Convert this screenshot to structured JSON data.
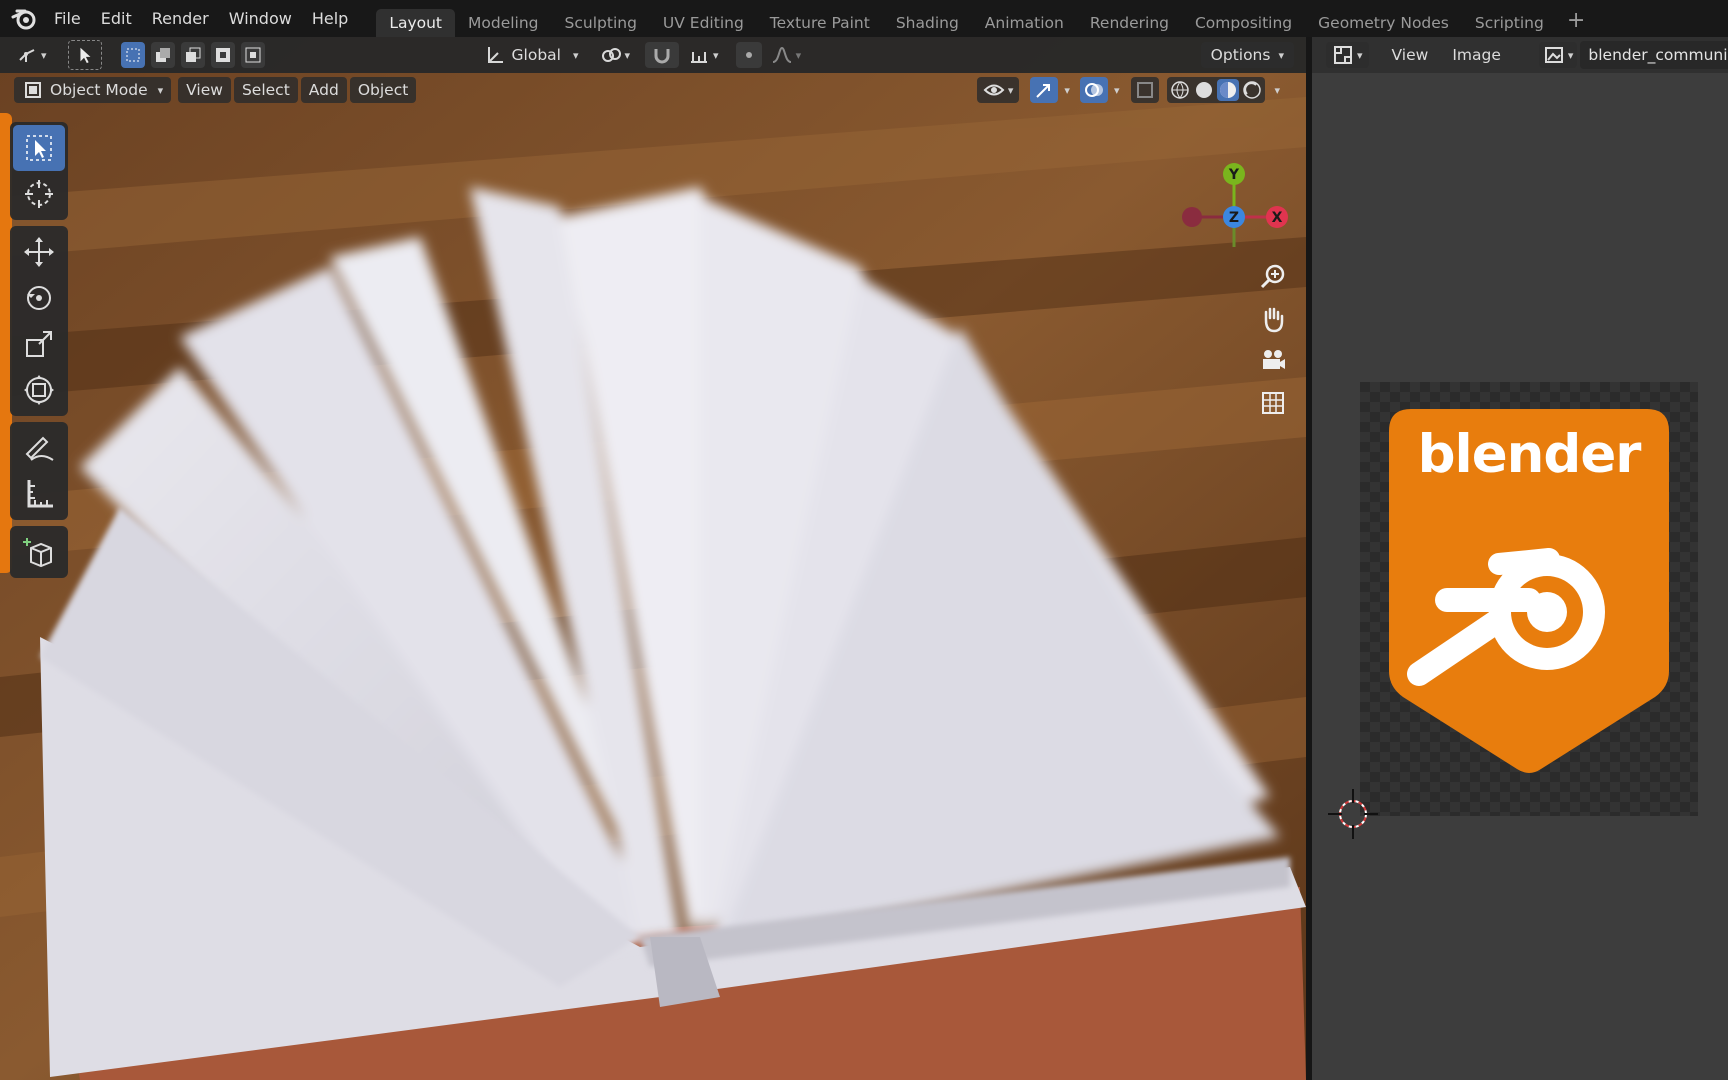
{
  "menu": {
    "items": [
      "File",
      "Edit",
      "Render",
      "Window",
      "Help"
    ]
  },
  "workspaces": {
    "tabs": [
      "Layout",
      "Modeling",
      "Sculpting",
      "UV Editing",
      "Texture Paint",
      "Shading",
      "Animation",
      "Rendering",
      "Compositing",
      "Geometry Nodes",
      "Scripting"
    ],
    "active": "Layout",
    "add_label": "+"
  },
  "tool_header": {
    "transform_orientation": "Global",
    "options_label": "Options"
  },
  "view_header": {
    "mode": "Object Mode",
    "menus": [
      "View",
      "Select",
      "Add",
      "Object"
    ]
  },
  "gizmo": {
    "x_label": "X",
    "y_label": "Y",
    "z_label": "Z",
    "x_color": "#e0344f",
    "y_color": "#7ab51d",
    "z_color": "#3b87e0"
  },
  "image_editor": {
    "menus": [
      "View",
      "Image"
    ],
    "image_name": "blender_community_",
    "badge_text": "blender",
    "badge_color": "#e87d0d"
  },
  "colors": {
    "accent_blue": "#4772b3",
    "blender_orange": "#e5770f"
  }
}
